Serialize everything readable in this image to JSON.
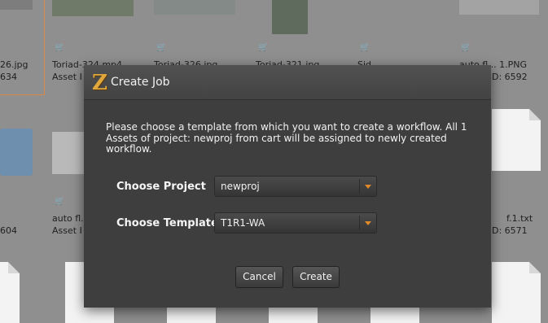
{
  "background_assets": [
    {
      "id": "a1",
      "label": "26.jpg",
      "asset_id": "634",
      "selected": true
    },
    {
      "id": "a2",
      "label": "Toriad-324.mp4",
      "asset_id": "Asset I"
    },
    {
      "id": "a3",
      "label": "Toriad-326.jpg",
      "asset_id": ""
    },
    {
      "id": "a4",
      "label": "Toriad-321.jpg",
      "asset_id": ""
    },
    {
      "id": "a5",
      "label": "Sid",
      "asset_id": ""
    },
    {
      "id": "a6",
      "label": "auto fl... 1.PNG",
      "asset_id": "D: 6592"
    },
    {
      "id": "b1",
      "label": "",
      "asset_id": "604"
    },
    {
      "id": "b2",
      "label": "auto fl.",
      "asset_id": "Asset I"
    },
    {
      "id": "b6",
      "label": "f.1.txt",
      "asset_id": "D: 6571"
    }
  ],
  "dialog": {
    "title": "Create Job",
    "logo": "Z",
    "message": "Please choose a template from which you want to create a workflow. All 1 Assets of project: newproj from cart will be assigned to newly created workflow.",
    "project_label": "Choose Project",
    "project_value": "newproj",
    "template_label": "Choose Template",
    "template_value": "T1R1-WA",
    "cancel_label": "Cancel",
    "create_label": "Create"
  },
  "colors": {
    "accent": "#e08a2a",
    "dialog_bg": "#3e3e3e",
    "overlay_bg": "#8f8f8f"
  }
}
